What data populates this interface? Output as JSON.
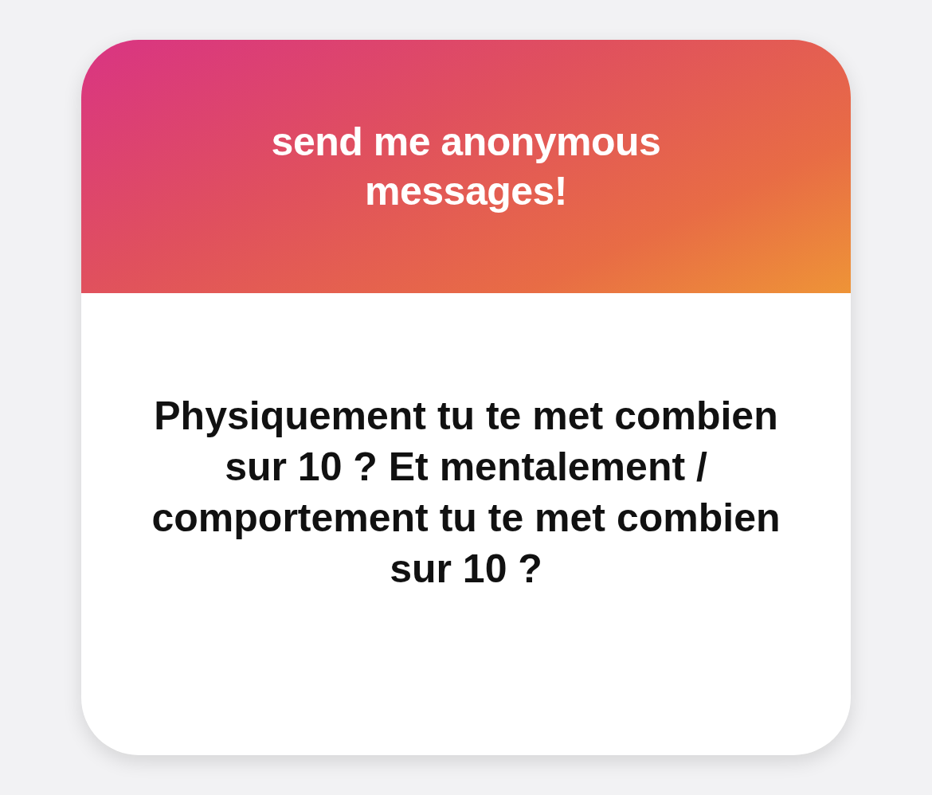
{
  "card": {
    "header": {
      "title": "send me anonymous messages!"
    },
    "message": "Physiquement tu te met combien sur 10 ? Et mentalement / comportement tu te met combien sur 10 ?"
  }
}
